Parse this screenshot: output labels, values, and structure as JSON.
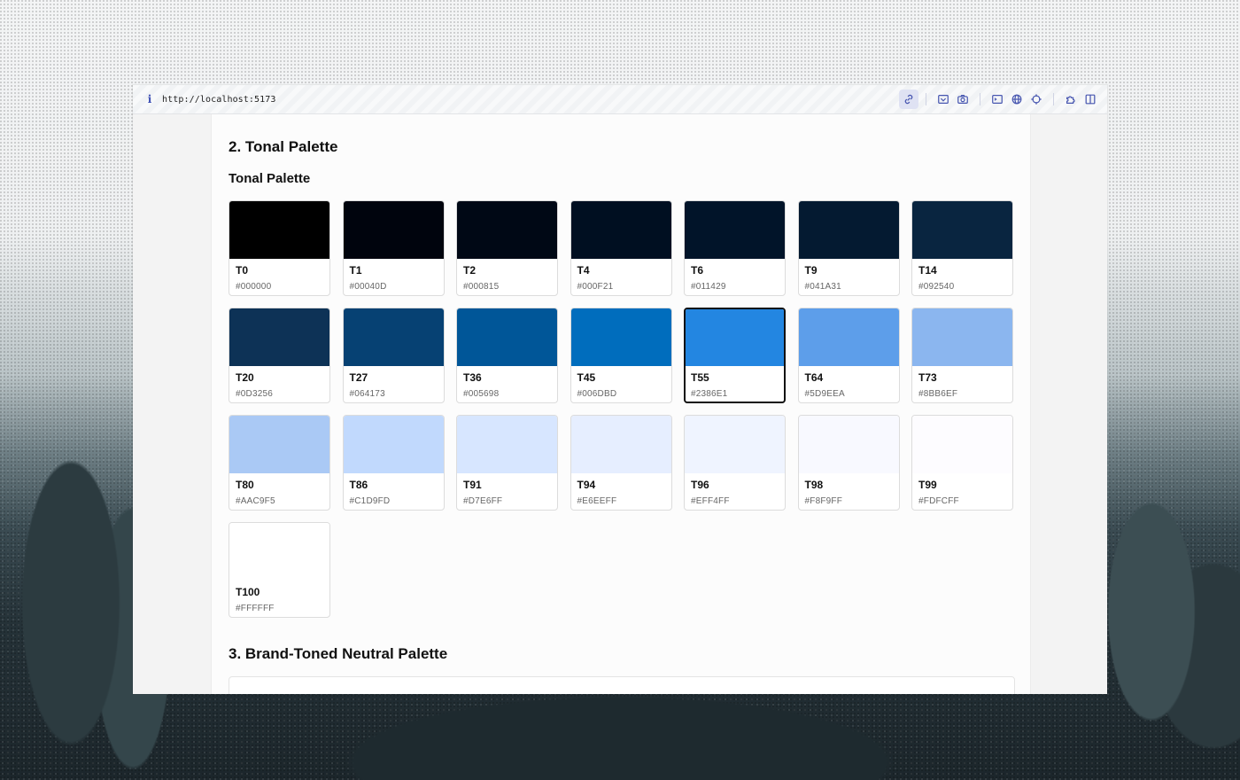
{
  "browser": {
    "url": "http://localhost:5173",
    "toolbar_icons": [
      "link-icon",
      "inspect-icon",
      "camera-icon",
      "terminal-icon",
      "globe-icon",
      "crosshair-icon",
      "extension-icon",
      "sidebar-icon"
    ]
  },
  "page": {
    "section2_title": "2. Tonal Palette",
    "subsection_title": "Tonal Palette",
    "section3_title": "3. Brand-Toned Neutral Palette"
  },
  "palette": [
    {
      "tone": "T0",
      "hex": "#000000",
      "color": "#000000"
    },
    {
      "tone": "T1",
      "hex": "#00040D",
      "color": "#00040D"
    },
    {
      "tone": "T2",
      "hex": "#000815",
      "color": "#000815"
    },
    {
      "tone": "T4",
      "hex": "#000F21",
      "color": "#000F21"
    },
    {
      "tone": "T6",
      "hex": "#011429",
      "color": "#011429"
    },
    {
      "tone": "T9",
      "hex": "#041A31",
      "color": "#041A31"
    },
    {
      "tone": "T14",
      "hex": "#092540",
      "color": "#092540"
    },
    {
      "tone": "T20",
      "hex": "#0D3256",
      "color": "#0D3256"
    },
    {
      "tone": "T27",
      "hex": "#064173",
      "color": "#064173"
    },
    {
      "tone": "T36",
      "hex": "#005698",
      "color": "#005698"
    },
    {
      "tone": "T45",
      "hex": "#006DBD",
      "color": "#006DBD"
    },
    {
      "tone": "T55",
      "hex": "#2386E1",
      "color": "#2386E1",
      "selected": true
    },
    {
      "tone": "T64",
      "hex": "#5D9EEA",
      "color": "#5D9EEA"
    },
    {
      "tone": "T73",
      "hex": "#8BB6EF",
      "color": "#8BB6EF"
    },
    {
      "tone": "T80",
      "hex": "#AAC9F5",
      "color": "#AAC9F5"
    },
    {
      "tone": "T86",
      "hex": "#C1D9FD",
      "color": "#C1D9FD"
    },
    {
      "tone": "T91",
      "hex": "#D7E6FF",
      "color": "#D7E6FF"
    },
    {
      "tone": "T94",
      "hex": "#E6EEFF",
      "color": "#E6EEFF"
    },
    {
      "tone": "T96",
      "hex": "#EFF4FF",
      "color": "#EFF4FF"
    },
    {
      "tone": "T98",
      "hex": "#F8F9FF",
      "color": "#F8F9FF"
    },
    {
      "tone": "T99",
      "hex": "#FDFCFF",
      "color": "#FDFCFF"
    },
    {
      "tone": "T100",
      "hex": "#FFFFFF",
      "color": "#FFFFFF"
    }
  ]
}
